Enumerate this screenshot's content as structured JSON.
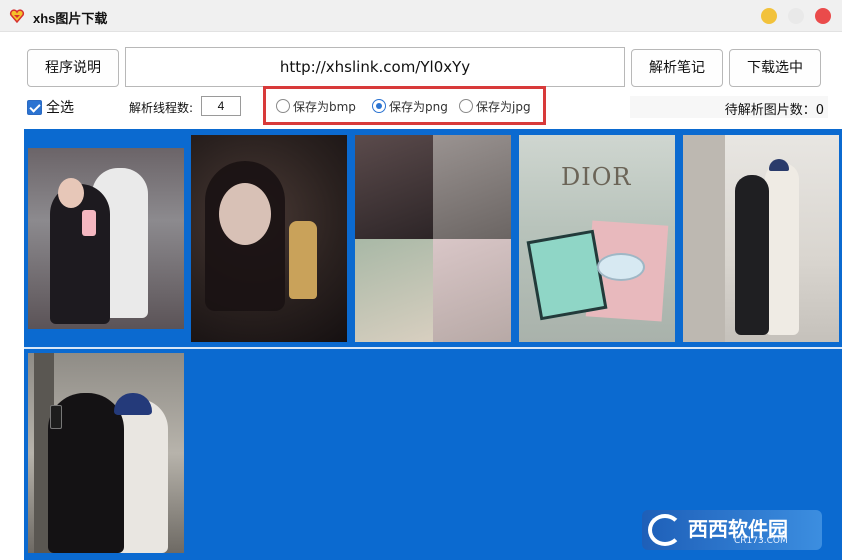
{
  "window": {
    "title": "xhs图片下载",
    "icon": "app-heart-icon"
  },
  "toolbar": {
    "help_label": "程序说明",
    "url_value": "http://xhslink.com/Yl0xYy",
    "parse_label": "解析笔记",
    "download_label": "下载选中"
  },
  "options": {
    "select_all_label": "全选",
    "select_all_checked": true,
    "threads_label": "解析线程数:",
    "threads_value": "4",
    "formats": [
      {
        "label": "保存为bmp",
        "checked": false
      },
      {
        "label": "保存为png",
        "checked": true
      },
      {
        "label": "保存为jpg",
        "checked": false
      }
    ],
    "pending_label": "待解析图片数：0"
  },
  "gallery": {
    "thumbnails": [
      {
        "name": "thumbnail-1",
        "selected": true
      },
      {
        "name": "thumbnail-2",
        "selected": true
      },
      {
        "name": "thumbnail-3",
        "selected": true
      },
      {
        "name": "thumbnail-4",
        "selected": true,
        "brand": "DIOR"
      },
      {
        "name": "thumbnail-5",
        "selected": true
      },
      {
        "name": "thumbnail-6",
        "selected": true
      }
    ],
    "selection_color": "#0b6ad0"
  },
  "watermark": {
    "text": "西西软件园",
    "sub": "CR173.COM"
  }
}
